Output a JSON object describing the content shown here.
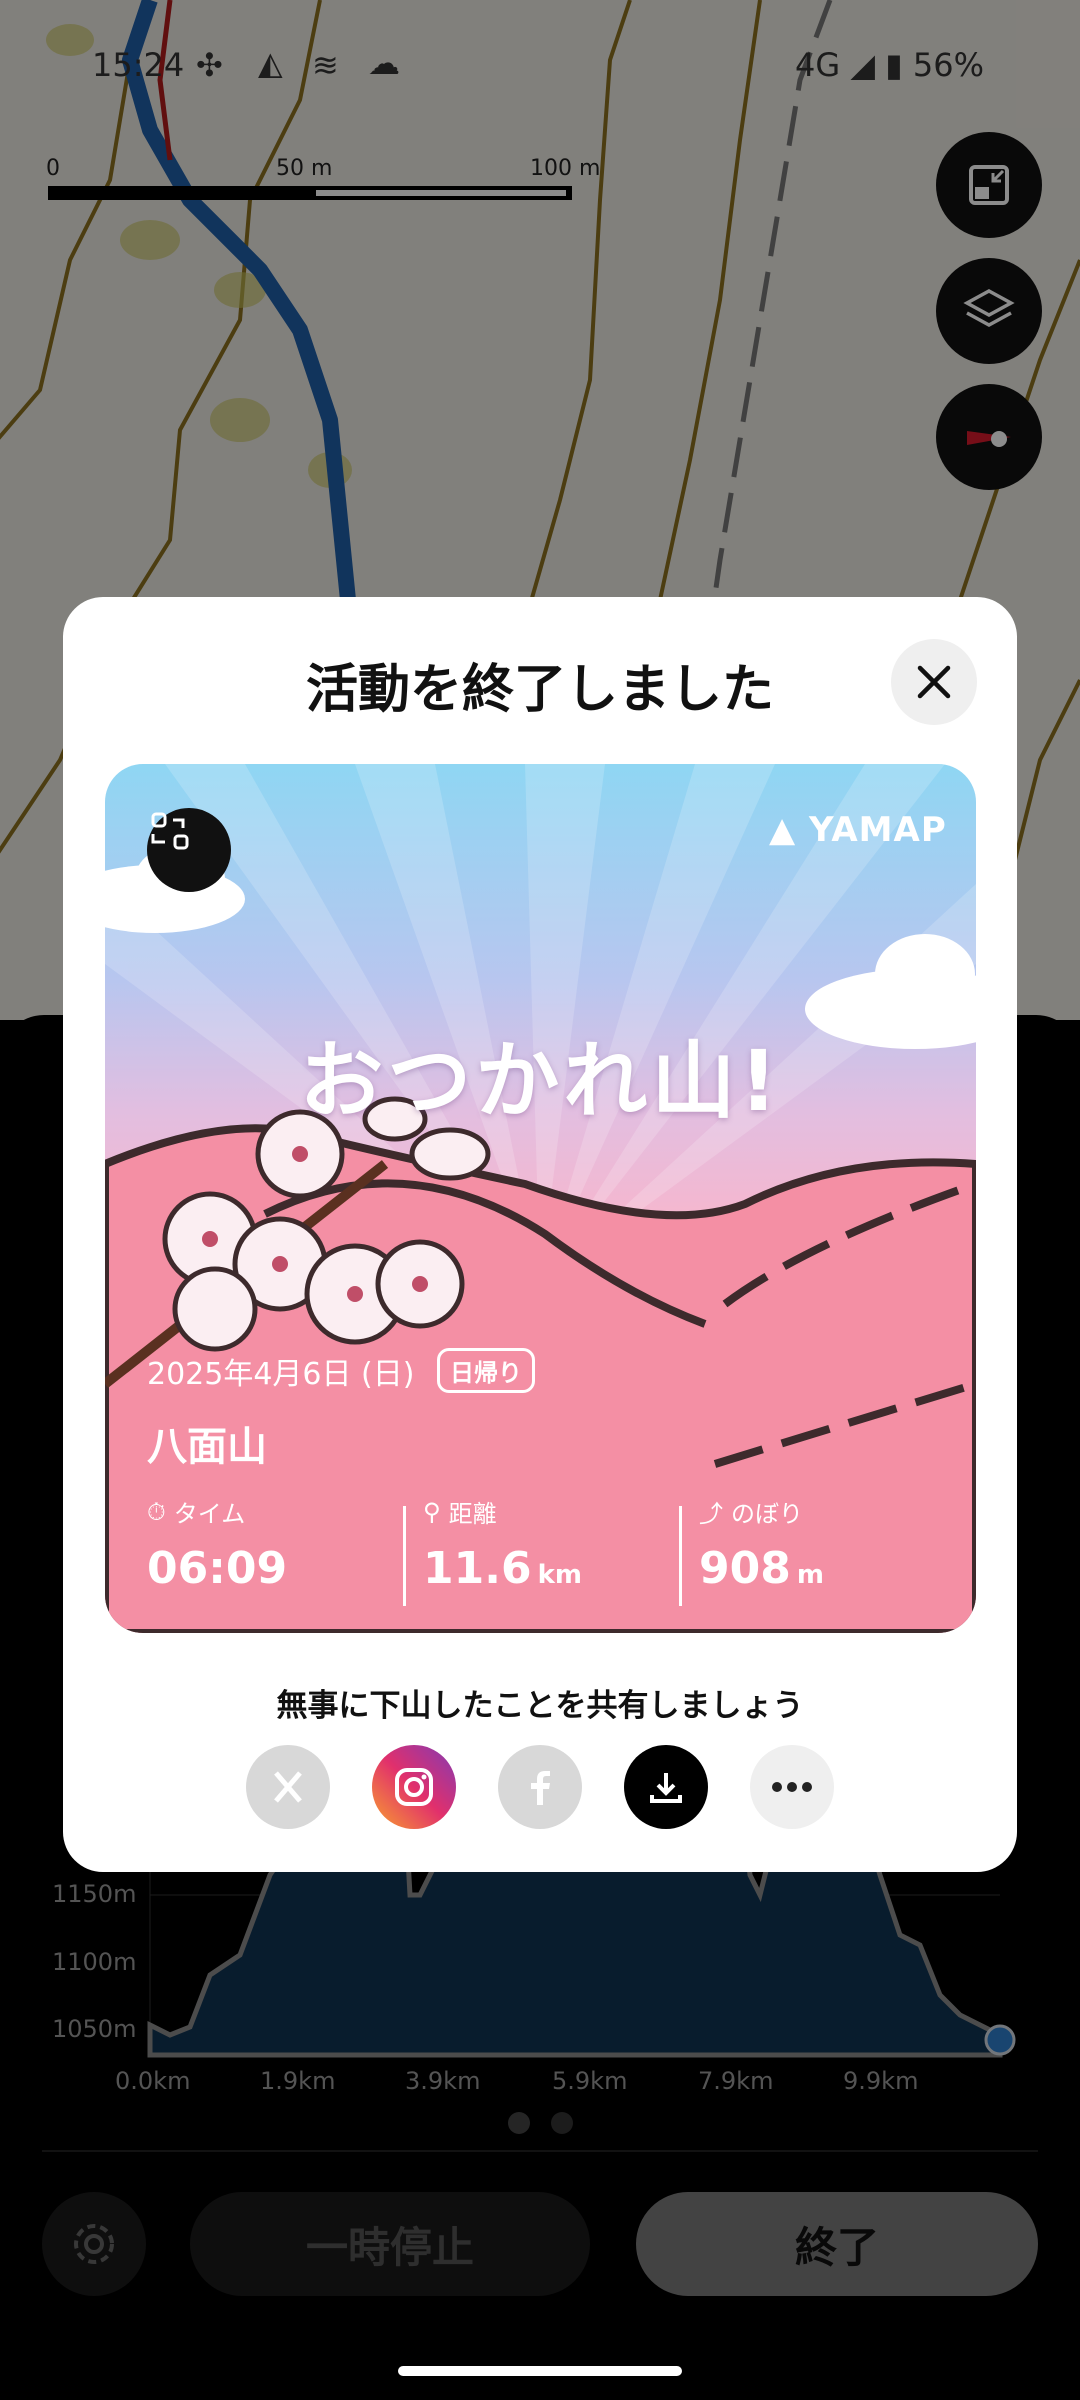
{
  "status_bar": {
    "time": "15:24",
    "network": "4G",
    "battery": "56%"
  },
  "scale": {
    "labels": [
      "0",
      "50 m",
      "100 m"
    ]
  },
  "map_buttons": [
    "fit-icon",
    "layers-icon",
    "compass-icon"
  ],
  "chart": {
    "y_labels": [
      "1150m",
      "1100m",
      "1050m"
    ],
    "x_labels": [
      "0.0km",
      "1.9km",
      "3.9km",
      "5.9km",
      "7.9km",
      "9.9km"
    ]
  },
  "bottom": {
    "pause_label": "一時停止",
    "finish_label": "終了"
  },
  "modal": {
    "title": "活動を終了しました",
    "card": {
      "brand": "YAMAP",
      "headline": "おつかれ山!",
      "date": "2025年4月6日 (日)",
      "badge": "日帰り",
      "mountain": "八面山",
      "stats": [
        {
          "label": "タイム",
          "value": "06:09",
          "unit": ""
        },
        {
          "label": "距離",
          "value": "11.6",
          "unit": "km"
        },
        {
          "label": "のぼり",
          "value": "908",
          "unit": "m"
        }
      ]
    },
    "share_text": "無事に下山したことを共有しましょう",
    "share_buttons": [
      "x-icon",
      "instagram-icon",
      "facebook-icon",
      "download-icon",
      "more-icon"
    ]
  },
  "colors": {
    "accent_dark": "#111111",
    "instagram": "#d6249f",
    "track_blue": "#1f5fa8"
  }
}
